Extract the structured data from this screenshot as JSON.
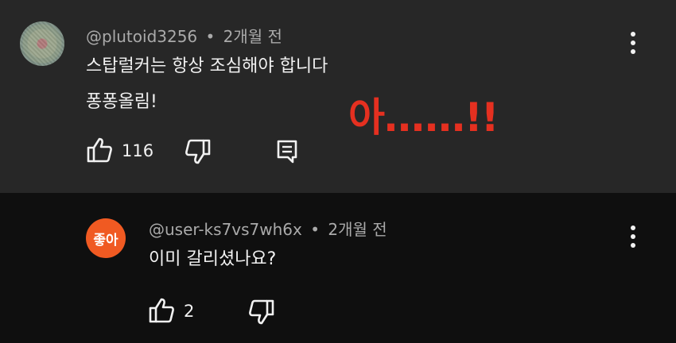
{
  "comment1": {
    "handle": "@plutoid3256",
    "separator": "•",
    "time": "2개월 전",
    "line1": "스탑럴커는 항상 조심해야 합니다",
    "line2": "퐁퐁올림!",
    "like_count": "116"
  },
  "overlay": {
    "text": "아......!!",
    "color": "#e53020"
  },
  "comment2": {
    "avatar_text": "좋아",
    "avatar_color": "#f05a22",
    "handle": "@user-ks7vs7wh6x",
    "separator": "•",
    "time": "2개월 전",
    "text": "이미 갈리셨나요?",
    "like_count": "2"
  },
  "icons": {
    "like": "thumbs-up-icon",
    "dislike": "thumbs-down-icon",
    "reply": "reply-icon",
    "menu": "more-vertical-icon"
  }
}
